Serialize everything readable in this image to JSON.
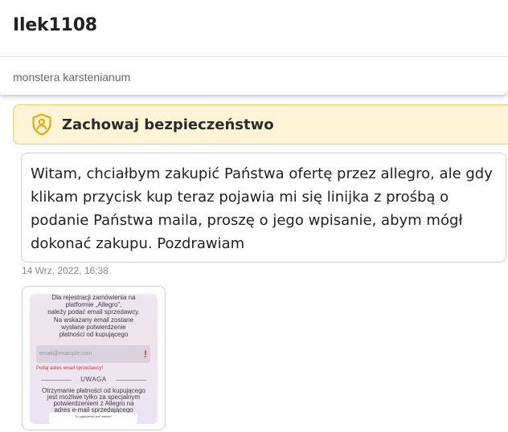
{
  "header": {
    "title": "Ilek1108",
    "subtitle": "monstera karstenianum"
  },
  "safety": {
    "icon": "shield-user-icon",
    "text": "Zachowaj bezpieczeństwo",
    "accent": "#f3d06e",
    "background": "#fff5d6"
  },
  "message": {
    "text": "Witam, chciałbym zakupić Państwa ofertę przez allegro, ale gdy klikam przycisk kup teraz pojawia mi się linijka z prośbą o podanie Państwa maila, proszę o jego wpisanie, abym mógł dokonać zakupu. Pozdrawiam",
    "timestamp": "14 Wrz. 2022, 16:38"
  },
  "attachment": {
    "lines_top": [
      "Dla rejestracji zamówienia na",
      "platformie „Allegro\",",
      "należy podać email sprzedawcy.",
      "Na wskazany email zostane",
      "wysłane potwierdzenie",
      "płatności od kupującego"
    ],
    "email_placeholder": "email@example.com",
    "error_text": "Podaj adres email sprzedawcy!",
    "warning_title": "UWAGA",
    "lines_bottom": [
      "Otrzymanie płatności od kupującego",
      "jest możliwe tylko za specjalnym",
      "potwierdzeniem z Allegro na",
      "adres e-mail sprzedającego"
    ],
    "footer": "To zgłoszenie jest ważne!"
  }
}
